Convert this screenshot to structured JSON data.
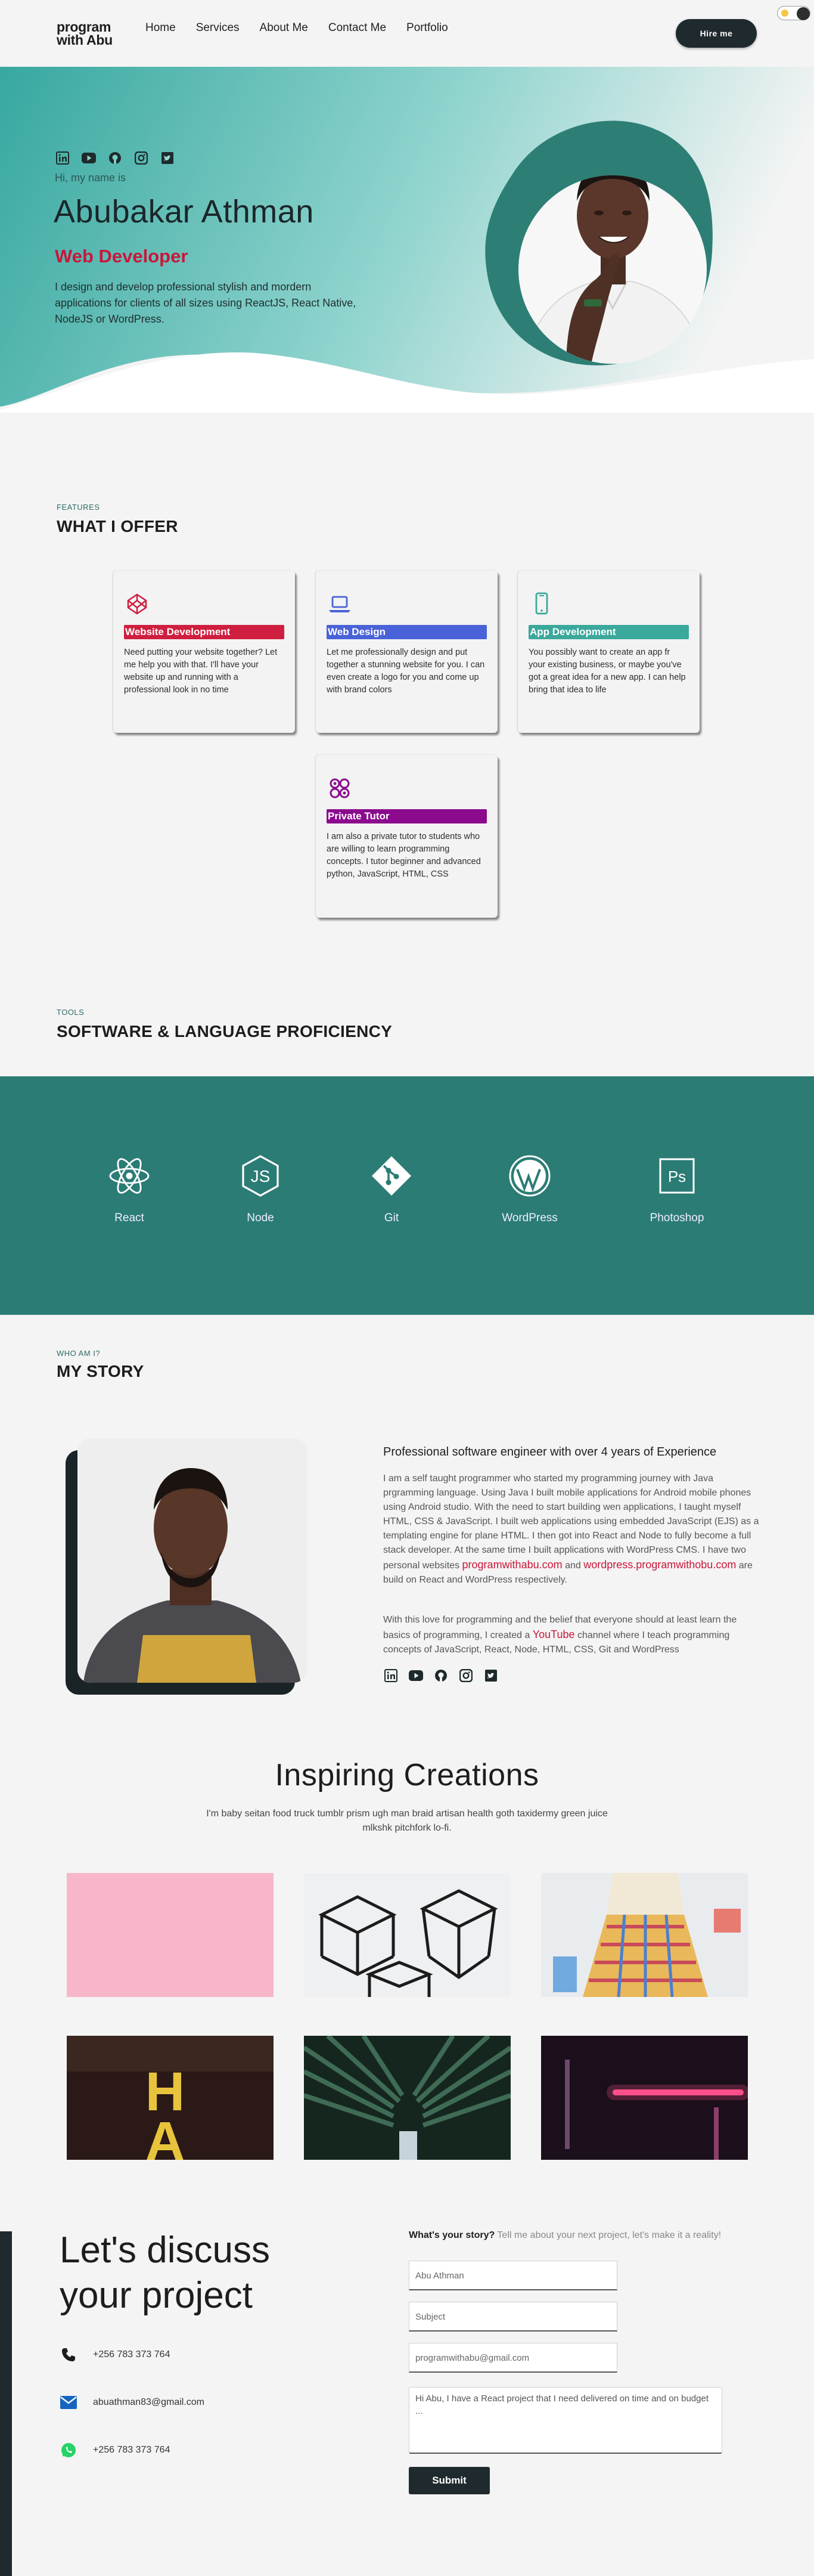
{
  "nav": {
    "logo_line1": "program",
    "logo_line2": "with Abu",
    "links": [
      "Home",
      "Services",
      "About Me",
      "Contact Me",
      "Portfolio"
    ],
    "hire_label": "Hire me"
  },
  "hero": {
    "greeting": "Hi, my name is",
    "name": "Abubakar Athman",
    "role": "Web Developer",
    "description": "I design and develop professional stylish and mordern applications for clients of all sizes using ReactJS, React Native, NodeJS or WordPress.",
    "socials": [
      "linkedin-icon",
      "youtube-icon",
      "github-icon",
      "instagram-icon",
      "twitter-icon"
    ]
  },
  "offer": {
    "kicker": "FEATURES",
    "title": "WHAT I OFFER",
    "cards": [
      {
        "title": "Website Development",
        "color": "#cf1e3f",
        "icon": "codepen-icon",
        "text": "Need putting your website together? Let me help you with that. I'll have your website up and running with a professional look in no time"
      },
      {
        "title": "Web Design",
        "color": "#4a62d8",
        "icon": "laptop-icon",
        "text": "Let me professionally design and put together a stunning website for you. I can even create a logo for you and come up with brand colors"
      },
      {
        "title": "App Development",
        "color": "#3ba89c",
        "icon": "mobile-icon",
        "text": "You possibly want to create an app fr your existing business, or maybe you've got a great idea for a new app. I can help bring that idea to life"
      },
      {
        "title": "Private Tutor",
        "color": "#8b0a8e",
        "icon": "tutor-icon",
        "text": "I am also a private tutor to students who are willing to learn programming concepts. I tutor beginner and advanced python, JavaScript, HTML, CSS"
      }
    ]
  },
  "tools": {
    "kicker": "TOOLS",
    "title": "SOFTWARE & LANGUAGE PROFICIENCY",
    "items": [
      {
        "label": "React",
        "icon": "react-icon"
      },
      {
        "label": "Node",
        "icon": "nodejs-icon"
      },
      {
        "label": "Git",
        "icon": "git-icon"
      },
      {
        "label": "WordPress",
        "icon": "wordpress-icon"
      },
      {
        "label": "Photoshop",
        "icon": "photoshop-icon"
      }
    ]
  },
  "story": {
    "kicker": "WHO AM I?",
    "title": "MY STORY",
    "heading": "Professional software engineer with over 4 years of Experience",
    "para1": "I am a self taught programmer who started my programming journey with Java prgramming language. Using Java I built mobile applications for Android mobile phones using Android studio. With the need to start building wen applications, I taught myself HTML, CSS & JavaScript. I built web applications using embedded JavaScript (EJS) as a templating engine for plane HTML. I then got into React and Node to fully become a full stack developer. At the same time I built applications with WordPress CMS. I have two personal websites",
    "link1": "programwithabu.com",
    "and": "and",
    "link2": "wordpress.programwithobu.com",
    "para1_end": "are build on React and WordPress respectively.",
    "para2_start": "With this love for programming and the belief that everyone should at least learn the basics of programming, I created a",
    "youtube": "YouTube",
    "para2_end": "channel where I teach programming concepts of JavaScript, React, Node, HTML, CSS, Git and WordPress"
  },
  "creations": {
    "title": "Inspiring Creations",
    "description": "I'm baby seitan food truck tumblr prism ugh man braid artisan health goth taxidermy green juice mlkshk pitchfork lo-fi."
  },
  "contact": {
    "title_line1": "Let's discuss",
    "title_line2": "your project",
    "phone": "+256 783 373 764",
    "email": "abuathman83@gmail.com",
    "whatsapp": "+256 783 373 764",
    "form_heading": "What's your story?",
    "form_sub": "Tell me about your next project, let's make it a reality!",
    "name_value": "Abu Athman",
    "subject_placeholder": "Subject",
    "email_value": "programwithabu@gmail.com",
    "message_value": "Hi Abu, I have a React project that I need delivered on time and on budget ...",
    "submit_label": "Submit"
  }
}
